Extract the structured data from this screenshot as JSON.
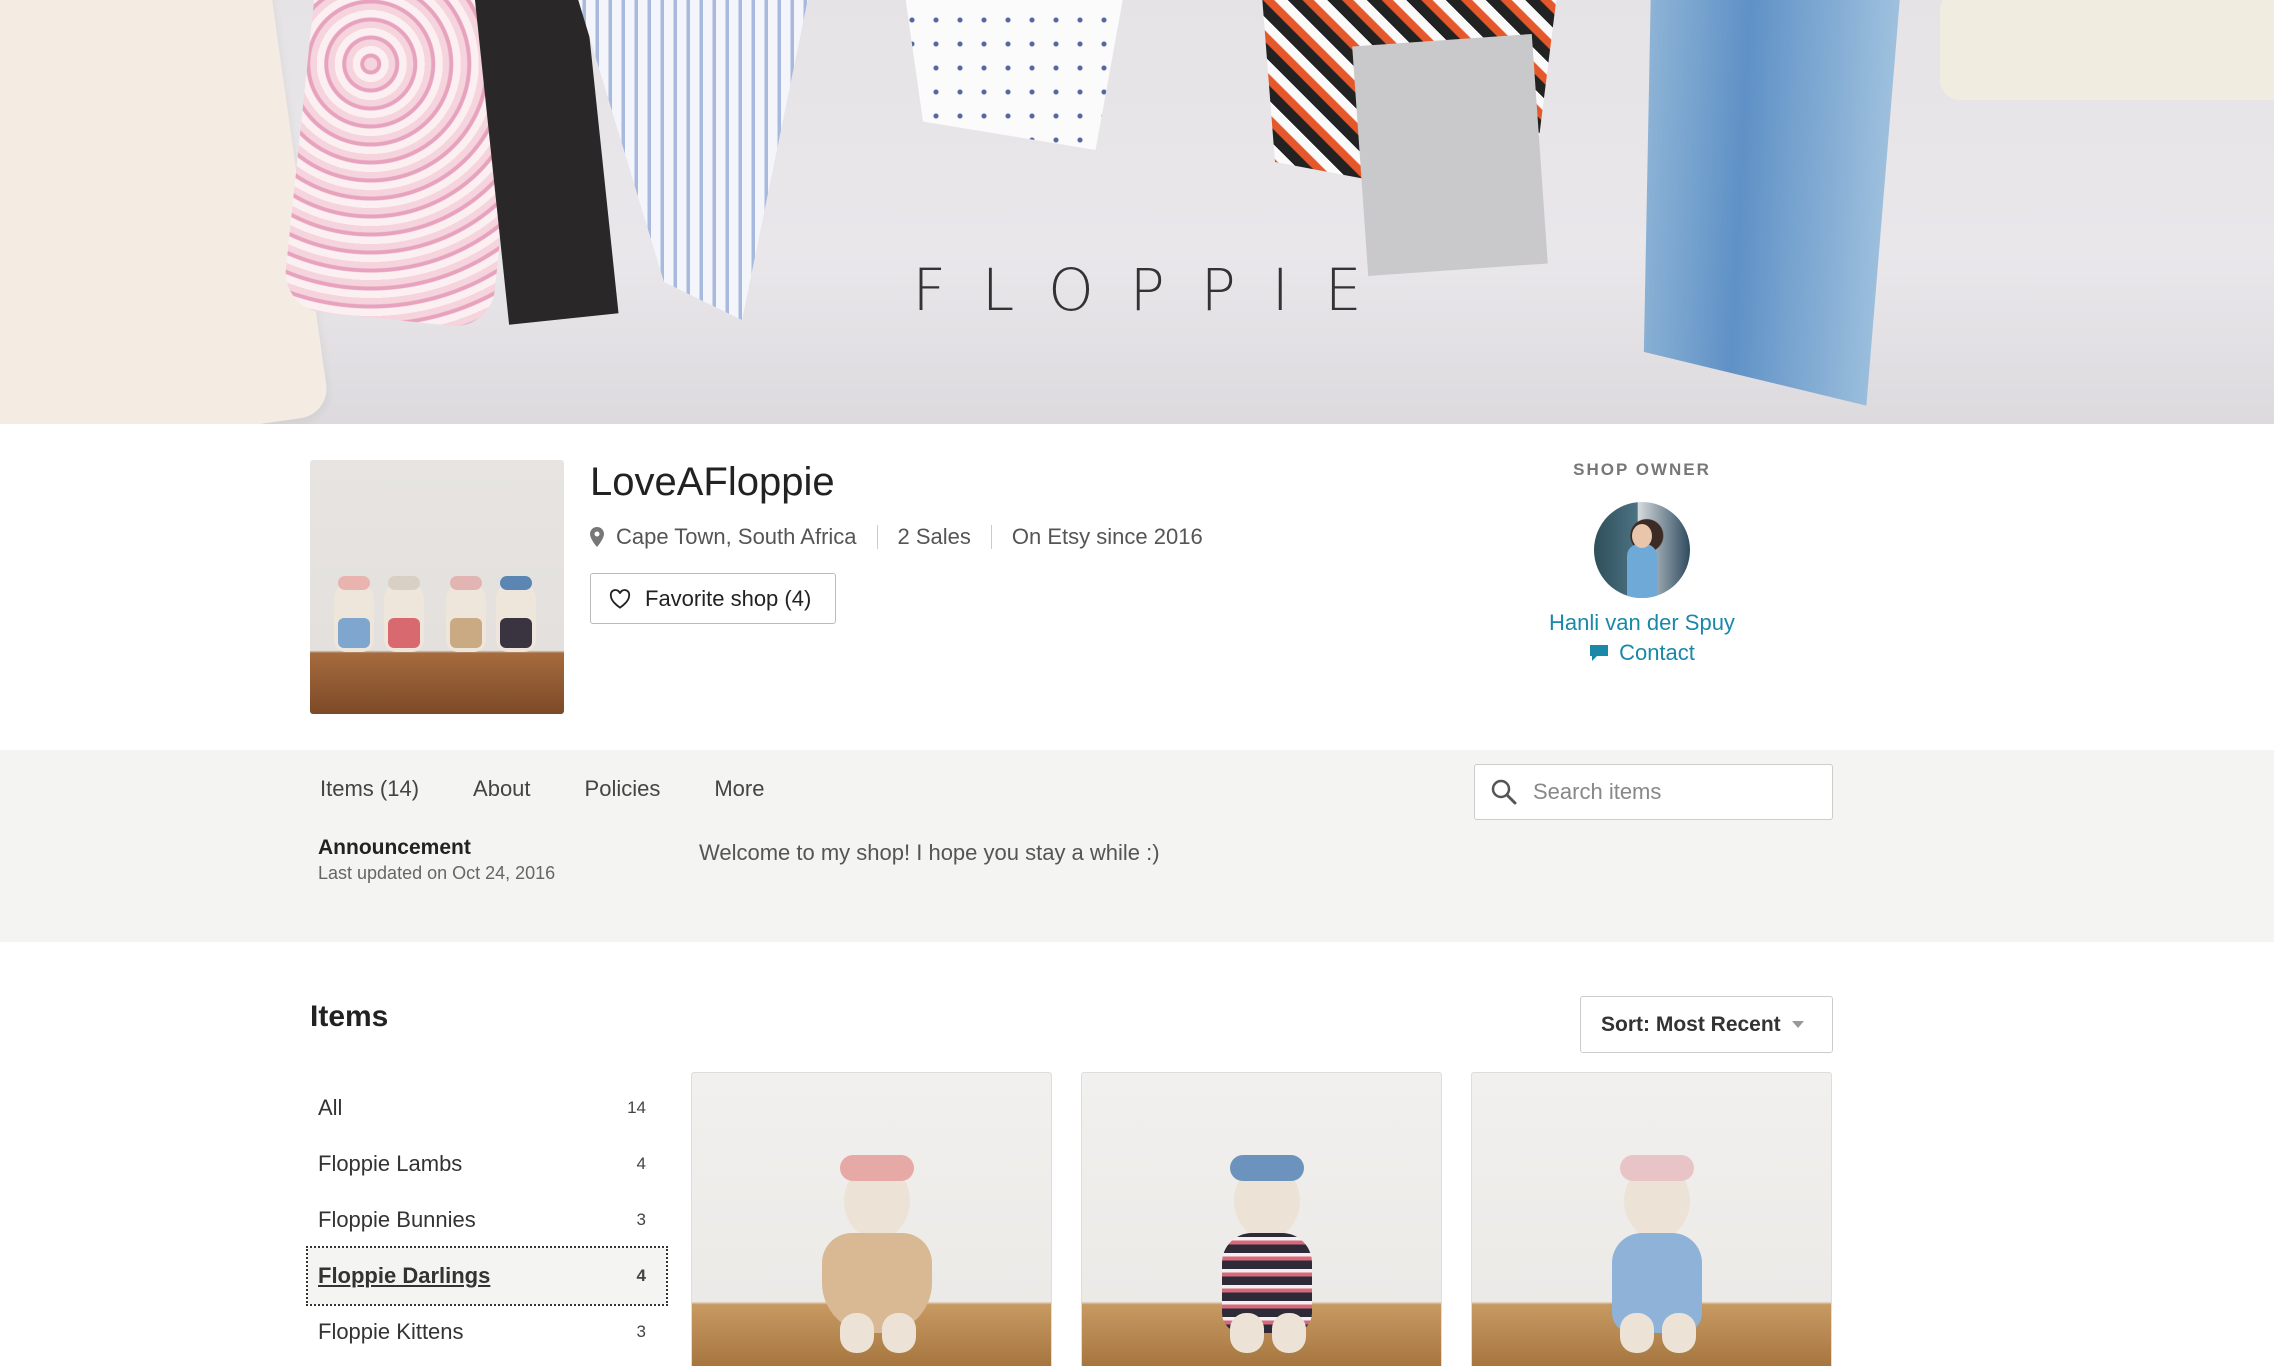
{
  "banner": {
    "logo_text": "FLOPPIE"
  },
  "shop": {
    "name": "LoveAFloppie",
    "location": "Cape Town, South Africa",
    "sales": "2 Sales",
    "since": "On Etsy since 2016",
    "favorite_label": "Favorite shop (4)"
  },
  "owner": {
    "label": "SHOP OWNER",
    "name": "Hanli van der Spuy",
    "contact_label": "Contact"
  },
  "nav": {
    "tabs": [
      "Items (14)",
      "About",
      "Policies",
      "More"
    ],
    "search_placeholder": "Search items"
  },
  "announcement": {
    "title": "Announcement",
    "updated": "Last updated on Oct 24, 2016",
    "text": "Welcome to my shop! I hope you stay a while :)"
  },
  "items": {
    "title": "Items",
    "sort_label": "Sort: Most Recent",
    "categories": [
      {
        "label": "All",
        "count": "14"
      },
      {
        "label": "Floppie Lambs",
        "count": "4"
      },
      {
        "label": "Floppie Bunnies",
        "count": "3"
      },
      {
        "label": "Floppie Darlings",
        "count": "4"
      },
      {
        "label": "Floppie Kittens",
        "count": "3"
      }
    ],
    "active_category": "Floppie Darlings"
  },
  "colors": {
    "link": "#1a88a8",
    "band": "#f4f4f2"
  }
}
